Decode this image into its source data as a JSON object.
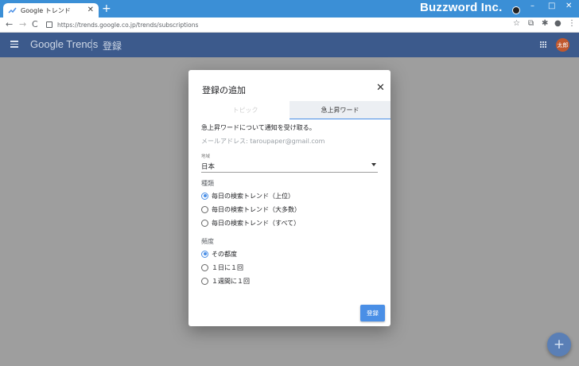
{
  "browser": {
    "tab_title": "Google トレンド",
    "tab_close": "✕",
    "new_tab": "+",
    "overlay_brand": "Buzzword Inc.",
    "url": "https://trends.google.co.jp/trends/subscriptions",
    "nav": {
      "back": "←",
      "forward": "→",
      "reload": "C"
    },
    "window_controls": {
      "minimize": "–",
      "maximize": "□",
      "close": "✕"
    }
  },
  "app": {
    "logo": "Google Trends",
    "section": "登録",
    "avatar_initials": "太郎"
  },
  "dialog": {
    "title": "登録の追加",
    "close": "✕",
    "tabs": [
      {
        "label": "トピック",
        "active": false
      },
      {
        "label": "急上昇ワード",
        "active": true
      }
    ],
    "description": "急上昇ワードについて通知を受け取る。",
    "email": "メールアドレス: taroupaper@gmail.com",
    "region": {
      "label": "地域",
      "value": "日本"
    },
    "type": {
      "label": "種類",
      "options": [
        {
          "label": "毎日の検索トレンド（上位）",
          "selected": true
        },
        {
          "label": "毎日の検索トレンド（大多数）",
          "selected": false
        },
        {
          "label": "毎日の検索トレンド（すべて）",
          "selected": false
        }
      ]
    },
    "frequency": {
      "label": "頻度",
      "options": [
        {
          "label": "その都度",
          "selected": true
        },
        {
          "label": "１日に１回",
          "selected": false
        },
        {
          "label": "１週間に１回",
          "selected": false
        }
      ]
    },
    "submit_label": "登録"
  },
  "fab_label": "+",
  "colors": {
    "accent": "#4a8fe6",
    "header": "#3c5a8c",
    "titlebar": "#3b8fd6"
  }
}
